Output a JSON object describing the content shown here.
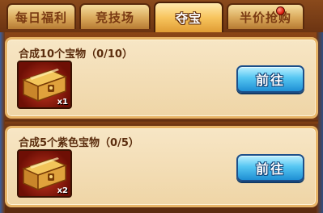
{
  "tabs": [
    {
      "label": "每日福利",
      "active": false
    },
    {
      "label": "竞技场",
      "active": false
    },
    {
      "label": "夺宝",
      "active": true
    },
    {
      "label": "半价抢购",
      "active": false,
      "has_notification": true
    }
  ],
  "tasks": [
    {
      "title": "合成10个宝物（0/10）",
      "reward_icon": "treasure-chest-icon",
      "reward_count": "x1",
      "button_label": "前往"
    },
    {
      "title": "合成5个紫色宝物（0/5）",
      "reward_icon": "treasure-chest-icon",
      "reward_count": "x2",
      "button_label": "前往"
    }
  ],
  "colors": {
    "active_tab": "#f7c45d",
    "button": "#55c6f2",
    "panel": "#f7e6c5",
    "notification": "#e02010"
  }
}
